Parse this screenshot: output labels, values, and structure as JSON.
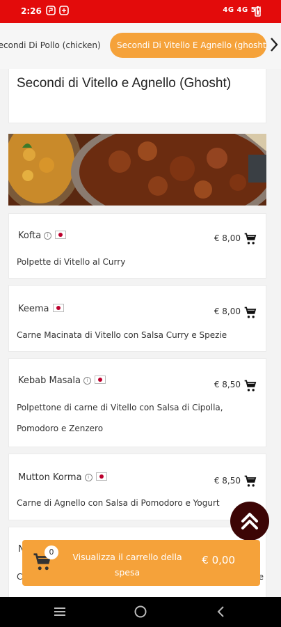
{
  "status_bar": {
    "time": "2:26",
    "right_text": "4G 4G 5ıl"
  },
  "categories": [
    {
      "label": "Secondi Di Pollo (chicken)",
      "active": false
    },
    {
      "label": "Secondi Di Vitello E Agnello (ghosht)",
      "active": true
    }
  ],
  "section": {
    "title": "Secondi di Vitello e Agnello (Ghosht)"
  },
  "items": [
    {
      "name": "Kofta",
      "price": "€ 8,00",
      "description": "Polpette di Vitello al Curry"
    },
    {
      "name": "Keema",
      "price": "€ 8,00",
      "description": "Carne Macinata di Vitello con Salsa Curry e Spezie"
    },
    {
      "name": "Kebab Masala",
      "price": "€ 8,50",
      "description": "Polpettone di carne di Vitello con Salsa di Cipolla, Pomodoro e Zenzero"
    },
    {
      "name": "Mutton Korma",
      "price": "€ 8,50",
      "description": "Carne di Agnello con Salsa di Pomodoro e Yogurt"
    }
  ],
  "partial_item": {
    "name_initial": "N",
    "desc_initial": "C",
    "desc_end": "e"
  },
  "cart": {
    "count": "0",
    "label": "Visualizza il carrello della spesa",
    "total": "€ 0,00"
  },
  "colors": {
    "status_red": "#e30b0b",
    "accent_orange": "#f5a23a",
    "dark_maroon": "#3c0505"
  }
}
